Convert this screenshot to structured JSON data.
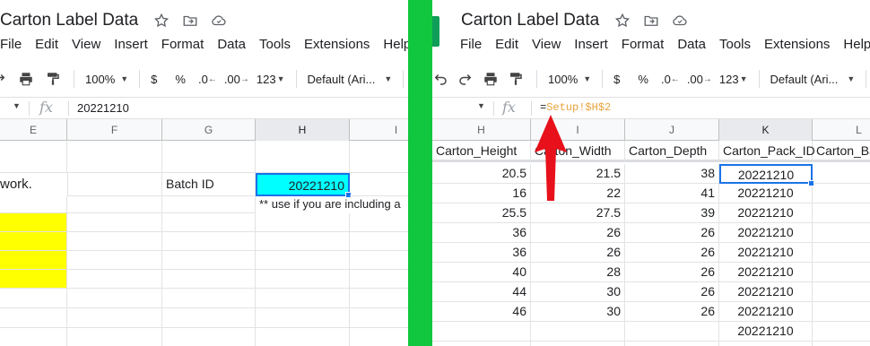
{
  "left": {
    "title": "Carton Label Data",
    "menu": [
      "File",
      "Edit",
      "View",
      "Insert",
      "Format",
      "Data",
      "Tools",
      "Extensions",
      "Help"
    ],
    "toolbar": {
      "zoom": "100%",
      "currency": "$",
      "percent": "%",
      "dec_decrease": ".0",
      "dec_increase": ".00",
      "format_more": "123",
      "font": "Default (Ari..."
    },
    "formula_value": "20221210",
    "columns": [
      "E",
      "F",
      "G",
      "H",
      "I"
    ],
    "cells": {
      "e_text": "work.",
      "batch_label": "Batch ID",
      "batch_value": "20221210",
      "note": "** use if you are including a"
    }
  },
  "right": {
    "title": "Carton Label Data",
    "menu": [
      "File",
      "Edit",
      "View",
      "Insert",
      "Format",
      "Data",
      "Tools",
      "Extensions",
      "Help"
    ],
    "toolbar": {
      "zoom": "100%",
      "currency": "$",
      "percent": "%",
      "dec_decrease": ".0",
      "dec_increase": ".00",
      "format_more": "123",
      "font": "Default (Ari..."
    },
    "formula": {
      "eq": "=",
      "ref": "Setup!$H$2"
    },
    "columns": [
      "H",
      "I",
      "J",
      "K",
      "L"
    ],
    "headers": [
      "Carton_Height",
      "Carton_Width",
      "Carton_Depth",
      "Carton_Pack_ID",
      "Carton_Ba"
    ],
    "rows": [
      [
        "20.5",
        "21.5",
        "38",
        "20221210"
      ],
      [
        "16",
        "22",
        "41",
        "20221210"
      ],
      [
        "25.5",
        "27.5",
        "39",
        "20221210"
      ],
      [
        "36",
        "26",
        "26",
        "20221210"
      ],
      [
        "36",
        "26",
        "26",
        "20221210"
      ],
      [
        "40",
        "28",
        "26",
        "20221210"
      ],
      [
        "44",
        "30",
        "26",
        "20221210"
      ],
      [
        "46",
        "30",
        "26",
        "20221210"
      ],
      [
        "",
        "",
        "",
        "20221210"
      ],
      [
        "",
        "",
        "",
        "20221210"
      ]
    ]
  },
  "colors": {
    "divider": "#11c73f",
    "highlight_cyan": "#00ffff",
    "highlight_yellow": "#ffff00",
    "arrow": "#e8101a",
    "formula_ref": "#e8a33d",
    "selection": "#1a73e8"
  }
}
